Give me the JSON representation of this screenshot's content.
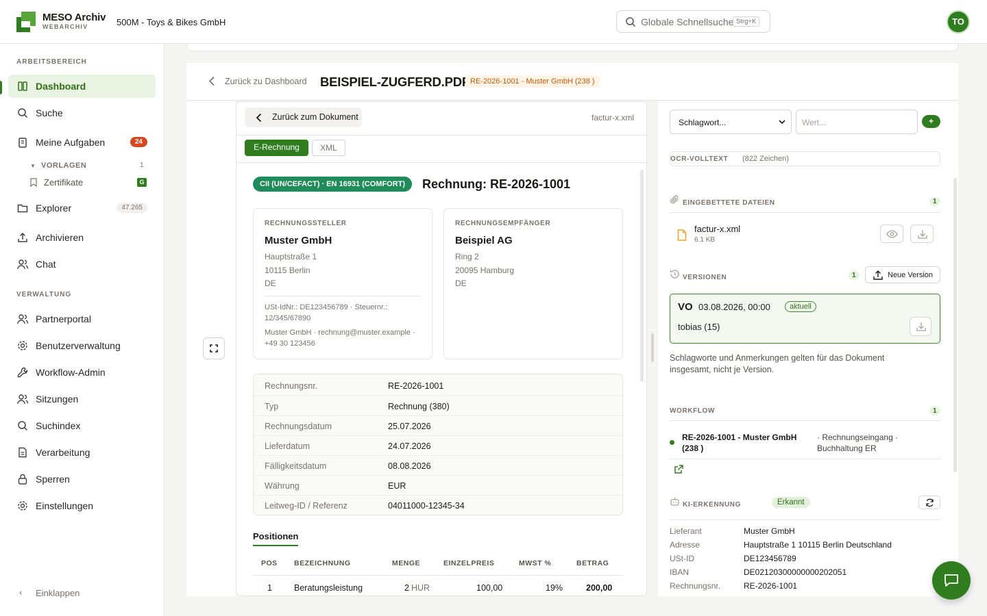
{
  "header": {
    "brand": "MESO Archiv",
    "brand_sub": "WEBARCHIV",
    "tenant": "500M - Toys & Bikes GmbH",
    "search_placeholder": "Globale Schnellsuche",
    "search_shortcut": "Strg+K",
    "avatar": "TO"
  },
  "sidebar": {
    "section_work": "ARBEITSBEREICH",
    "dashboard": "Dashboard",
    "suche": "Suche",
    "aufgaben": "Meine Aufgaben",
    "aufgaben_count": "24",
    "vorlagen": "VORLAGEN",
    "vorlagen_count": "1",
    "zertifikate": "Zertifikate",
    "zertifikate_badge": "G",
    "explorer": "Explorer",
    "explorer_count": "47.265",
    "archivieren": "Archivieren",
    "chat": "Chat",
    "section_admin": "VERWALTUNG",
    "partnerportal": "Partnerportal",
    "benutzer": "Benutzerverwaltung",
    "workflow": "Workflow-Admin",
    "sitzungen": "Sitzungen",
    "suchindex": "Suchindex",
    "verarbeitung": "Verarbeitung",
    "sperren": "Sperren",
    "einstellungen": "Einstellungen",
    "collapse": "Einklappen"
  },
  "titlebar": {
    "back": "Zurück zu Dashboard",
    "title": "BEISPIEL-ZUGFERD.PDF",
    "badge": "RE-2026-1001 - Muster GmbH (238 )"
  },
  "viewer": {
    "back": "Zurück zum Dokument",
    "filename": "factur-x.xml",
    "tab_erechnung": "E-Rechnung",
    "tab_xml": "XML",
    "profile": "CII (UN/CEFACT) · EN 16931 (COMFORT)",
    "invoice_title": "Rechnung: RE-2026-1001",
    "seller": {
      "label": "RECHNUNGSSTELLER",
      "name": "Muster GmbH",
      "street": "Hauptstraße 1",
      "city": "10115 Berlin",
      "country": "DE",
      "tax1": "USt-IdNr.: DE123456789 · Steuernr.:",
      "tax2": "12/345/67890",
      "contact1": "Muster GmbH · rechnung@muster.example ·",
      "contact2": "+49 30 123456"
    },
    "buyer": {
      "label": "RECHNUNGSEMPFÄNGER",
      "name": "Beispiel AG",
      "street": "Ring 2",
      "city": "20095 Hamburg",
      "country": "DE"
    },
    "details": [
      {
        "k": "Rechnungsnr.",
        "v": "RE-2026-1001"
      },
      {
        "k": "Typ",
        "v": "Rechnung (380)"
      },
      {
        "k": "Rechnungsdatum",
        "v": "25.07.2026"
      },
      {
        "k": "Lieferdatum",
        "v": "24.07.2026"
      },
      {
        "k": "Fälligkeitsdatum",
        "v": "08.08.2026"
      },
      {
        "k": "Währung",
        "v": "EUR"
      },
      {
        "k": "Leitweg-ID / Referenz",
        "v": "04011000-12345-34"
      }
    ],
    "positions_tab": "Positionen",
    "cols": {
      "pos": "POS",
      "bez": "BEZEICHNUNG",
      "menge": "MENGE",
      "einzel": "EINZELPREIS",
      "mwst": "MWST %",
      "betrag": "BETRAG"
    },
    "row1": {
      "pos": "1",
      "bez": "Beratungsleistung",
      "menge": "2",
      "unit": "HUR",
      "einzel": "100,00",
      "mwst": "19%",
      "betrag": "200,00"
    }
  },
  "right": {
    "tag_select": "Schlagwort...",
    "value_placeholder": "Wert...",
    "add": "+",
    "ocr_label": "OCR-VOLLTEXT",
    "ocr_count": "(822 Zeichen)",
    "embedded_label": "EINGEBETTETE DATEIEN",
    "embedded_count": "1",
    "file_name": "factur-x.xml",
    "file_size": "6.1 KB",
    "versions_label": "VERSIONEN",
    "versions_count": "1",
    "new_version": "Neue Version",
    "version": {
      "code": "VO",
      "date": "03.08.2026, 00:00",
      "status": "aktuell",
      "user": "tobias (15)"
    },
    "note": "Schlagworte und Anmerkungen gelten für das Dokument insgesamt, nicht je Version.",
    "workflow_label": "WORKFLOW",
    "workflow_count": "1",
    "wf_title1": "RE-2026-1001 - Muster GmbH",
    "wf_title2": "(238 )",
    "wf_desc1": "· Rechnungseingang ·",
    "wf_desc2": "Buchhaltung ER",
    "ki_label": "KI-ERKENNUNG",
    "ki_status": "Erkannt",
    "ki": [
      {
        "k": "Lieferant",
        "v": "Muster GmbH"
      },
      {
        "k": "Adresse",
        "v": "Hauptstraße 1 10115 Berlin Deutschland"
      },
      {
        "k": "USt-ID",
        "v": "DE123456789"
      },
      {
        "k": "IBAN",
        "v": "DE02120300000000202051"
      },
      {
        "k": "Rechnungsnr.",
        "v": "RE-2026-1001"
      }
    ]
  },
  "colors": {
    "brand": "#2f7d1e",
    "brand_light": "#e8f3e2",
    "badge_red": "#d9481c",
    "badge_orange": "#c2590a"
  }
}
